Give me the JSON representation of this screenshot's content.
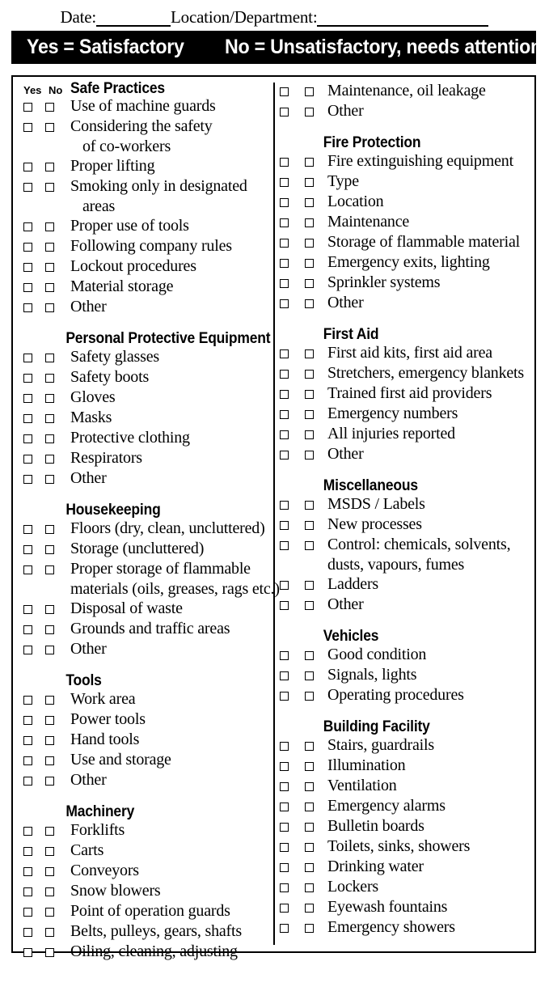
{
  "header": {
    "date_label": "Date:",
    "location_label": "Location/Department:",
    "banner_yes": "Yes = Satisfactory",
    "banner_no": "No = Unsatisfactory, needs attention"
  },
  "columns": {
    "yes_label": "Yes",
    "no_label": "No",
    "left": [
      {
        "heading": "Safe Practices",
        "inline_heading": true,
        "items": [
          {
            "label": "Use of machine guards"
          },
          {
            "label": "Considering the safety",
            "cont": "of co-workers"
          },
          {
            "label": "Proper lifting"
          },
          {
            "label": "Smoking only in designated",
            "cont": "areas"
          },
          {
            "label": "Proper use of tools"
          },
          {
            "label": "Following company rules"
          },
          {
            "label": "Lockout procedures"
          },
          {
            "label": "Material storage"
          },
          {
            "label": "Other"
          }
        ]
      },
      {
        "heading": "Personal Protective Equipment",
        "items": [
          {
            "label": "Safety glasses"
          },
          {
            "label": "Safety boots"
          },
          {
            "label": "Gloves"
          },
          {
            "label": "Masks"
          },
          {
            "label": "Protective clothing"
          },
          {
            "label": "Respirators"
          },
          {
            "label": "Other"
          }
        ]
      },
      {
        "heading": "Housekeeping",
        "items": [
          {
            "label": "Floors (dry, clean, uncluttered)"
          },
          {
            "label": "Storage (uncluttered)"
          },
          {
            "label": "Proper storage of flammable",
            "cont": "materials (oils, greases, rags etc.)",
            "cont_flush": true
          },
          {
            "label": "Disposal of waste"
          },
          {
            "label": "Grounds and traffic areas"
          },
          {
            "label": "Other"
          }
        ]
      },
      {
        "heading": "Tools",
        "items": [
          {
            "label": "Work area"
          },
          {
            "label": "Power tools"
          },
          {
            "label": "Hand tools"
          },
          {
            "label": "Use and storage"
          },
          {
            "label": "Other"
          }
        ]
      },
      {
        "heading": "Machinery",
        "items": [
          {
            "label": "Forklifts"
          },
          {
            "label": "Carts"
          },
          {
            "label": "Conveyors"
          },
          {
            "label": "Snow blowers"
          },
          {
            "label": "Point of operation guards"
          },
          {
            "label": "Belts, pulleys, gears, shafts"
          },
          {
            "label": "Oiling, cleaning, adjusting"
          }
        ]
      }
    ],
    "right": [
      {
        "heading": "",
        "items": [
          {
            "label": "Maintenance, oil leakage"
          },
          {
            "label": "Other"
          }
        ]
      },
      {
        "heading": "Fire Protection",
        "items": [
          {
            "label": "Fire extinguishing equipment"
          },
          {
            "label": "Type"
          },
          {
            "label": "Location"
          },
          {
            "label": "Maintenance"
          },
          {
            "label": "Storage of flammable material"
          },
          {
            "label": "Emergency exits, lighting"
          },
          {
            "label": "Sprinkler systems"
          },
          {
            "label": "Other"
          }
        ]
      },
      {
        "heading": "First Aid",
        "items": [
          {
            "label": "First aid kits, first aid area"
          },
          {
            "label": "Stretchers, emergency blankets"
          },
          {
            "label": "Trained first aid providers"
          },
          {
            "label": "Emergency numbers"
          },
          {
            "label": "All injuries reported"
          },
          {
            "label": "Other"
          }
        ]
      },
      {
        "heading": "Miscellaneous",
        "items": [
          {
            "label": "MSDS / Labels"
          },
          {
            "label": "New processes"
          },
          {
            "label": "Control: chemicals, solvents,",
            "cont": "dusts, vapours, fumes",
            "cont_flush": true
          },
          {
            "label": "Ladders"
          },
          {
            "label": "Other"
          }
        ]
      },
      {
        "heading": "Vehicles",
        "items": [
          {
            "label": "Good condition"
          },
          {
            "label": "Signals, lights"
          },
          {
            "label": "Operating procedures"
          }
        ]
      },
      {
        "heading": "Building Facility",
        "items": [
          {
            "label": "Stairs, guardrails"
          },
          {
            "label": "Illumination"
          },
          {
            "label": "Ventilation"
          },
          {
            "label": "Emergency alarms"
          },
          {
            "label": "Bulletin boards"
          },
          {
            "label": "Toilets, sinks, showers"
          },
          {
            "label": "Drinking water"
          },
          {
            "label": "Lockers"
          },
          {
            "label": "Eyewash fountains"
          },
          {
            "label": "Emergency showers"
          }
        ]
      }
    ]
  }
}
